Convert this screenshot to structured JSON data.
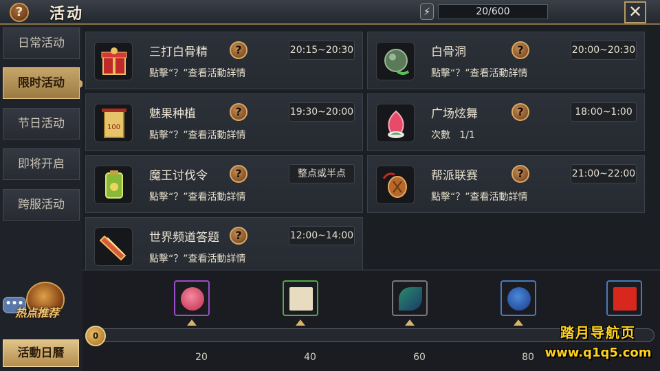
{
  "header": {
    "help": "?",
    "title": "活动",
    "energy_icon": "lightning-icon",
    "energy": "20/600",
    "close": "✕"
  },
  "sidebar": {
    "tabs": [
      "日常活动",
      "限时活动",
      "节日活动",
      "即将开启",
      "跨服活动"
    ],
    "active_index": 1,
    "hot_label": "热点推荐",
    "chat": "•••",
    "calendar_button": "活動日曆"
  },
  "activities": [
    {
      "name": "三打白骨精",
      "time": "20:15~20:30",
      "desc": "點擊“？”查看活動詳情",
      "icon": "gift-box-icon"
    },
    {
      "name": "白骨洞",
      "time": "20:00~20:30",
      "desc": "點擊“？”查看活動詳情",
      "icon": "jade-orb-icon"
    },
    {
      "name": "魅果种植",
      "time": "19:30~20:00",
      "desc": "點擊“？”查看活動詳情",
      "icon": "scroll-banner-icon"
    },
    {
      "name": "广场炫舞",
      "time": "18:00~1:00",
      "desc": "次數   1/1",
      "icon": "peach-icon"
    },
    {
      "name": "魔王讨伐令",
      "time": "整点或半点",
      "desc": "點擊“？”查看活動詳情",
      "icon": "jade-token-icon"
    },
    {
      "name": "帮派联赛",
      "time": "21:00~22:00",
      "desc": "點擊“？”查看活動詳情",
      "icon": "pouch-icon"
    },
    {
      "name": "世界频道答题",
      "time": "12:00~14:00",
      "desc": "點擊“？”查看活動詳情",
      "icon": "scroll-icon"
    }
  ],
  "progress": {
    "current": "0",
    "milestones": [
      {
        "value": "20",
        "icon": "peach-reward-icon",
        "frame": "#9a4fc8"
      },
      {
        "value": "40",
        "icon": "document-reward-icon",
        "frame": "#58a84a"
      },
      {
        "value": "60",
        "icon": "feather-reward-icon",
        "frame": "#7a7a7a"
      },
      {
        "value": "80",
        "icon": "bag-reward-icon",
        "frame": "#4a7ab8"
      },
      {
        "value": "",
        "icon": "red-envelope-reward-icon",
        "frame": "#4a7ab8"
      }
    ]
  },
  "watermark": {
    "line1": "踏月导航页",
    "line2": "www.q1q5.com"
  },
  "colors": {
    "accent_gold": "#c9a86e",
    "panel": "#2c3038",
    "text": "#ece5d3"
  }
}
